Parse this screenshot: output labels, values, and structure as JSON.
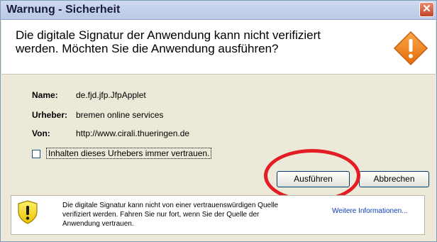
{
  "window": {
    "title": "Warnung - Sicherheit",
    "close_glyph": "✕"
  },
  "header": {
    "headline": "Die digitale Signatur der Anwendung kann nicht verifiziert werden.  Möchten Sie die Anwendung ausführen?",
    "icon": "warning-diamond-icon"
  },
  "fields": [
    {
      "label": "Name:",
      "value": "de.fjd.jfp.JfpApplet"
    },
    {
      "label": "Urheber:",
      "value": "bremen online services"
    },
    {
      "label": "Von:",
      "value": "http://www.cirali.thueringen.de"
    }
  ],
  "trust_checkbox": {
    "label": "Inhalten dieses Urhebers immer vertrauen.",
    "checked": false
  },
  "buttons": {
    "run": "Ausführen",
    "cancel": "Abbrechen"
  },
  "annotation": {
    "color": "#e31d24"
  },
  "footer": {
    "icon": "shield-warning-icon",
    "text": "Die digitale Signatur kann nicht von einer vertrauenswürdigen Quelle\nverifiziert werden.  Fahren Sie nur fort, wenn Sie der Quelle der\nAnwendung vertrauen.",
    "link": "Weitere Informationen..."
  },
  "colors": {
    "warning_orange": "#ef7d12",
    "link_blue": "#0b3cb2"
  }
}
